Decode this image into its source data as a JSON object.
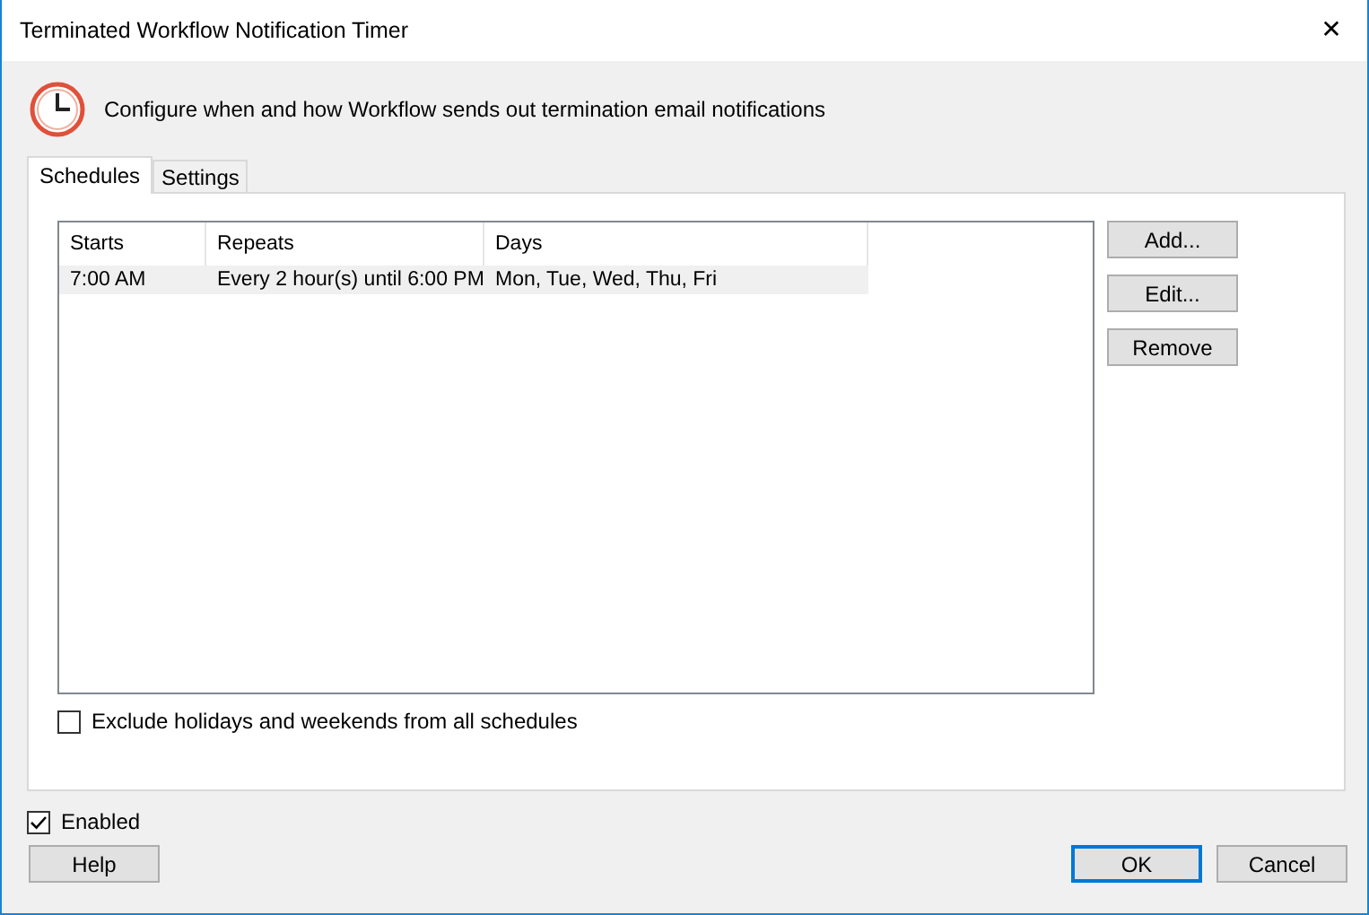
{
  "window": {
    "title": "Terminated Workflow Notification Timer",
    "close": "✕"
  },
  "description": "Configure when and how Workflow sends out termination email notifications",
  "tabs": [
    {
      "label": "Schedules",
      "selected": true
    },
    {
      "label": "Settings",
      "selected": false
    }
  ],
  "table": {
    "columns": [
      "Starts",
      "Repeats",
      "Days"
    ],
    "rows": [
      {
        "cells": [
          "7:00 AM",
          "Every 2 hour(s) until 6:00 PM",
          "Mon, Tue, Wed, Thu, Fri"
        ],
        "selected": true
      }
    ]
  },
  "side_buttons": [
    "Add...",
    "Edit...",
    "Remove"
  ],
  "exclude_holidays": {
    "label": "Exclude holidays and weekends from all schedules",
    "checked": false
  },
  "enabled": {
    "label": "Enabled",
    "checked": true
  },
  "buttons": [
    {
      "label": "Help",
      "default": false
    },
    {
      "label": "OK",
      "default": true
    },
    {
      "label": "Cancel",
      "default": false
    }
  ]
}
